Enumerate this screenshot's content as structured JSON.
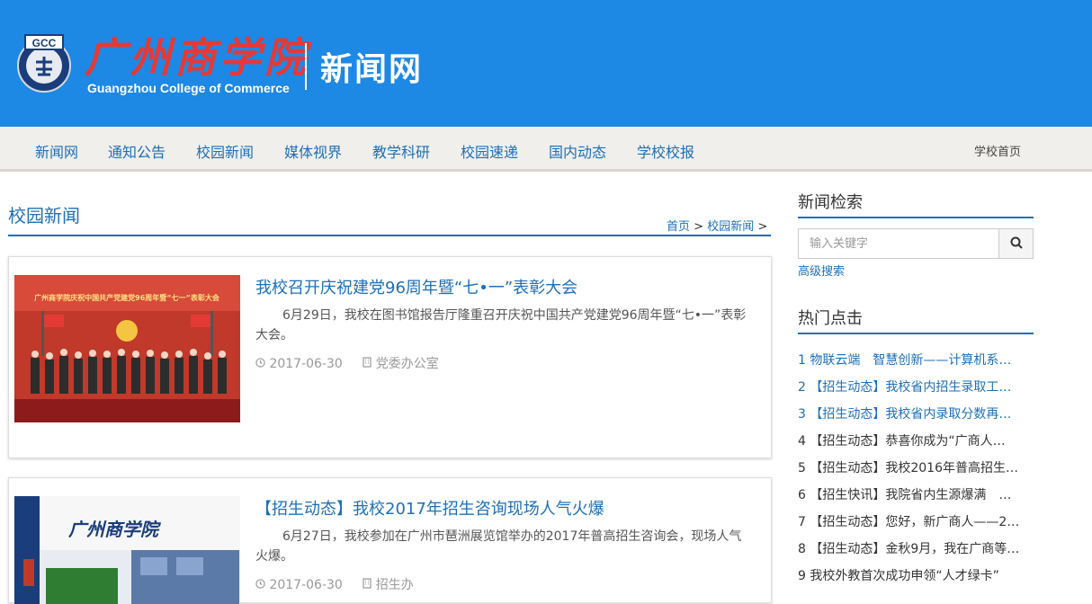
{
  "header": {
    "logo_abbrev": "GCC",
    "school_name_cn": "广州商学院",
    "school_name_en": "Guangzhou College of Commerce",
    "site_name": "新闻网"
  },
  "nav": {
    "items": [
      "新闻网",
      "通知公告",
      "校园新闻",
      "媒体视界",
      "教学科研",
      "校园速递",
      "国内动态",
      "学校校报"
    ],
    "right_link": "学校首页"
  },
  "main": {
    "section_title": "校园新闻",
    "breadcrumb": {
      "home": "首页",
      "sep": ">",
      "current": "校园新闻",
      "tail": ">"
    },
    "articles": [
      {
        "title": "我校召开庆祝建党96周年暨“七•一”表彰大会",
        "summary": "6月29日，我校在图书馆报告厅隆重召开庆祝中国共产党建党96周年暨“七•一”表彰大会。",
        "date": "2017-06-30",
        "department": "党委办公室",
        "banner_text": "广州商学院庆祝中国共产党建党96周年暨“七一”表彰大会"
      },
      {
        "title": "【招生动态】我校2017年招生咨询现场人气火爆",
        "summary": "6月27日，我校参加在广州市琶洲展览馆举办的2017年普高招生咨询会，现场人气火爆。",
        "date": "2017-06-30",
        "department": "招生办",
        "booth_text": "广州商学院"
      }
    ]
  },
  "sidebar": {
    "search_title": "新闻检索",
    "search_placeholder": "输入关键字",
    "advanced_search": "高级搜索",
    "hot_title": "热门点击",
    "hot_items": [
      "1 物联云端　智慧创新——计算机系…",
      "2 【招生动态】我校省内招生录取工…",
      "3 【招生动态】我校省内录取分数再…",
      "4 【招生动态】恭喜你成为“广商人…",
      "5 【招生动态】我校2016年普高招生…",
      "6 【招生快讯】我院省内生源爆满　…",
      "7 【招生动态】您好，新广商人——2…",
      "8 【招生动态】金秋9月，我在广商等…",
      "9 我校外教首次成功申领“人才绿卡”"
    ]
  },
  "colors": {
    "header_blue": "#1e88e5",
    "link_blue": "#1e6fb8",
    "logo_red": "#e53935"
  },
  "icons": {
    "search": "search-icon",
    "date": "clock-icon",
    "department": "building-icon"
  }
}
